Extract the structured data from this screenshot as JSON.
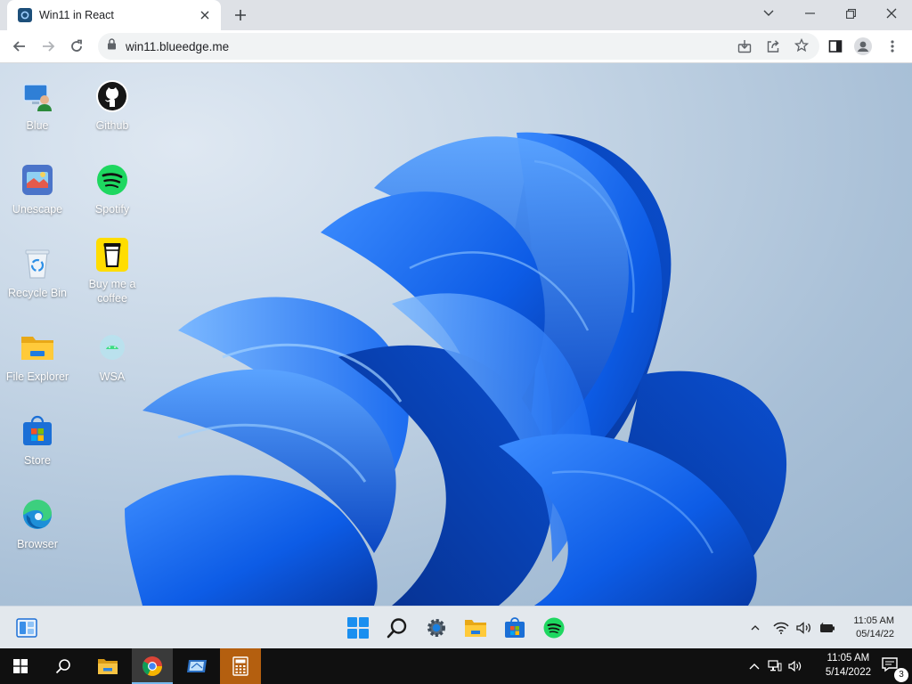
{
  "browser": {
    "tab_title": "Win11 in React",
    "url": "win11.blueedge.me"
  },
  "desktop": {
    "icons": [
      {
        "label": "Blue",
        "icon": "user-pc-icon"
      },
      {
        "label": "Github",
        "icon": "github-icon"
      },
      {
        "label": "Unescape",
        "icon": "unescape-icon"
      },
      {
        "label": "Spotify",
        "icon": "spotify-icon"
      },
      {
        "label": "Recycle Bin",
        "icon": "recycle-bin-icon"
      },
      {
        "label": "Buy me a coffee",
        "icon": "coffee-cup-icon"
      },
      {
        "label": "File Explorer",
        "icon": "folder-icon"
      },
      {
        "label": "WSA",
        "icon": "wsa-icon"
      },
      {
        "label": "Store",
        "icon": "store-icon"
      },
      {
        "label": "Browser",
        "icon": "edge-icon"
      }
    ]
  },
  "win11_taskbar": {
    "clock_time": "11:05 AM",
    "clock_date": "05/14/22",
    "pinned": [
      "start-icon",
      "search-icon",
      "settings-icon",
      "file-explorer-icon",
      "store-icon",
      "spotify-icon"
    ]
  },
  "host_taskbar": {
    "clock_time": "11:05 AM",
    "clock_date": "5/14/2022",
    "notification_count": "3"
  },
  "colors": {
    "accent": "#0a5fd8",
    "spotify": "#1ed760",
    "host_taskbar": "#101010",
    "calc_active": "#b45f0f"
  }
}
